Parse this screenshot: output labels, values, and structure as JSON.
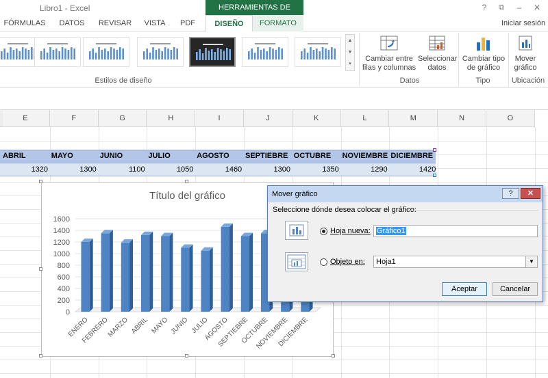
{
  "window": {
    "title": "Libro1 - Excel",
    "help": "?",
    "restore": "⧉",
    "minimize": "–",
    "close": "✕",
    "signin": "Iniciar sesión"
  },
  "context_header": "HERRAMIENTAS DE GRÁFICOS",
  "tabs": [
    "FÓRMULAS",
    "DATOS",
    "REVISAR",
    "VISTA",
    "PDF"
  ],
  "active_tab": "DISEÑO",
  "formato_tab": "FORMATO",
  "ribbon": {
    "styles_group": "Estilos de diseño",
    "datos_group": "Datos",
    "tipo_group": "Tipo",
    "ubicacion_group": "Ubicación",
    "btn_switch": [
      "Cambiar entre",
      "filas y columnas"
    ],
    "btn_select": [
      "Seleccionar",
      "datos"
    ],
    "btn_change_type": [
      "Cambiar tipo",
      "de gráfico"
    ],
    "btn_move": [
      "Mover",
      "gráfico"
    ]
  },
  "columns": [
    "E",
    "F",
    "G",
    "H",
    "I",
    "J",
    "K",
    "L",
    "M",
    "N",
    "O"
  ],
  "sheet": {
    "months": [
      "ABRIL",
      "MAYO",
      "JUNIO",
      "JULIO",
      "AGOSTO",
      "SEPTIEBRE",
      "OCTUBRE",
      "NOVIEMBRE",
      "DICIEMBRE"
    ],
    "values": [
      "1320",
      "1300",
      "1100",
      "1050",
      "1460",
      "1300",
      "1350",
      "1290",
      "1420"
    ]
  },
  "chart_data": {
    "type": "bar",
    "title": "Título del gráfico",
    "categories": [
      "ENERO",
      "FEBRERO",
      "MARZO",
      "ABRIL",
      "MAYO",
      "JUNIO",
      "JULIO",
      "AGOSTO",
      "SEPTIEBRE",
      "OCTUBRE",
      "NOVIEMBRE",
      "DICIEMBRE"
    ],
    "values": [
      1200,
      1350,
      1190,
      1320,
      1300,
      1100,
      1050,
      1460,
      1300,
      1350,
      1290,
      1420
    ],
    "yticks": [
      "0",
      "200",
      "400",
      "600",
      "800",
      "1000",
      "1200",
      "1400",
      "1600"
    ],
    "ylim": [
      0,
      1600
    ],
    "bar_color": "#4e84c4"
  },
  "dialog": {
    "title": "Mover gráfico",
    "help": "?",
    "close": "✕",
    "prompt": "Seleccione dónde desea colocar el gráfico:",
    "option_new": "Hoja nueva:",
    "option_object": "Objeto en:",
    "new_sheet_value": "Gráfico1",
    "object_value": "Hoja1",
    "accept": "Aceptar",
    "cancel": "Cancelar"
  },
  "colors": {
    "accent": "#217346",
    "header_row": "#b4c6e7",
    "value_row": "#dce6f2",
    "bar": "#4e84c4"
  }
}
